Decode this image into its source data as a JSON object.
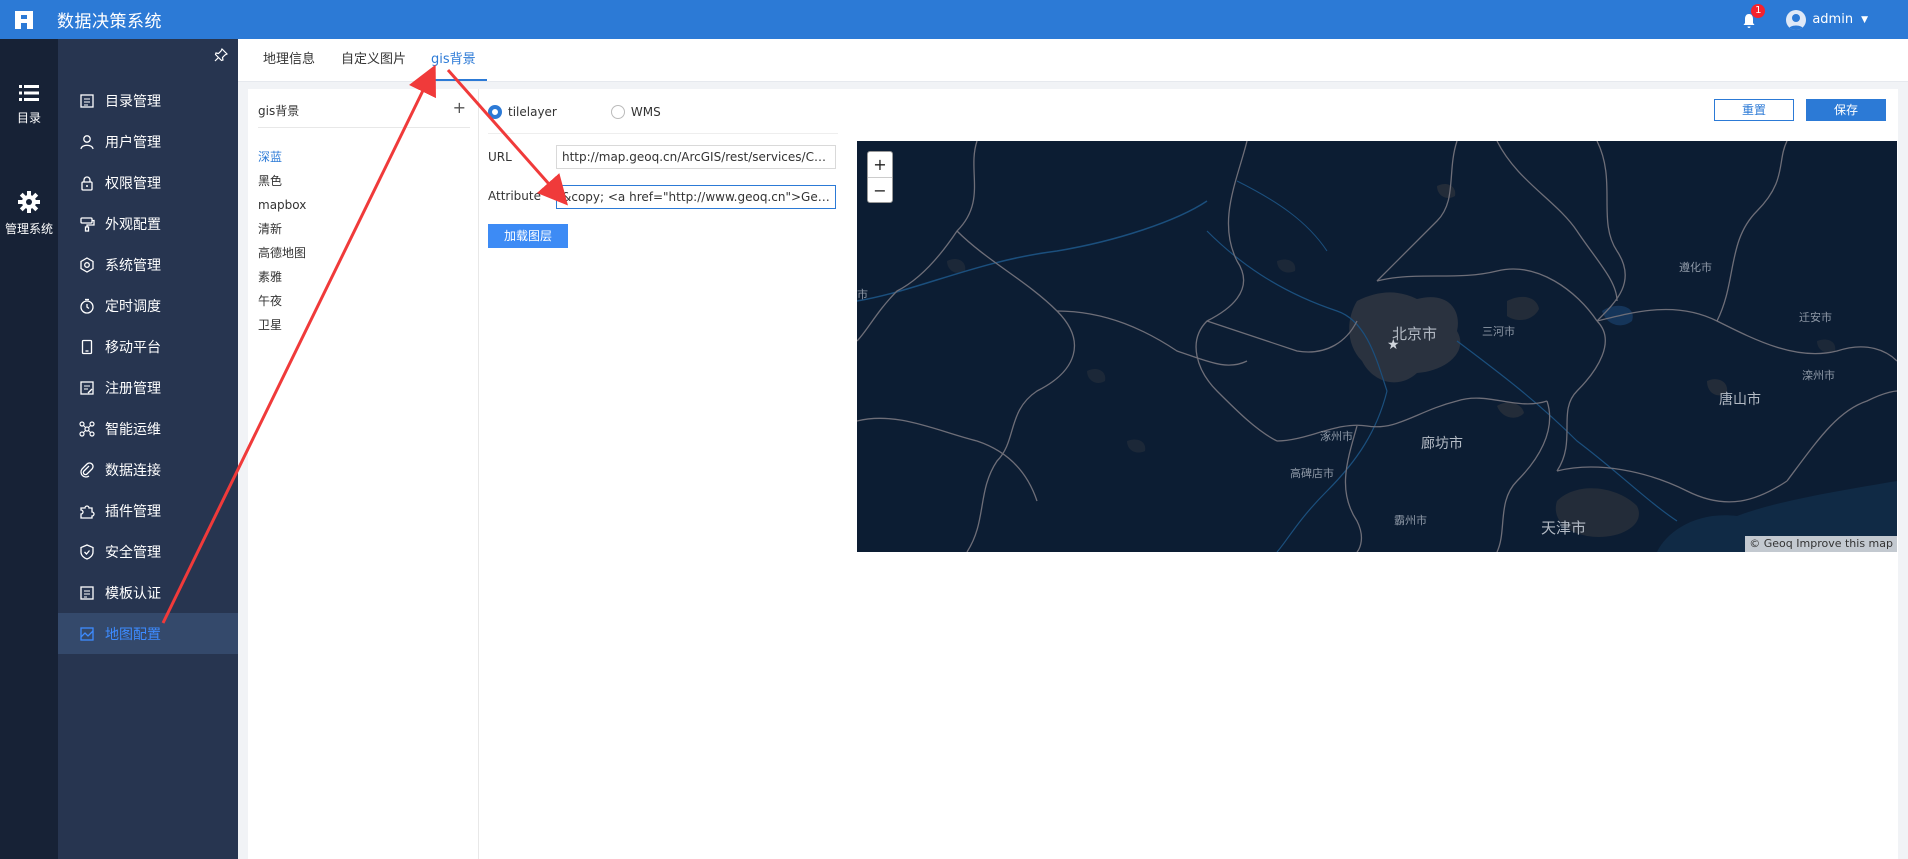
{
  "header": {
    "title": "数据决策系统",
    "notifications": "1",
    "user": "admin"
  },
  "rail": {
    "items": [
      {
        "label": "目录",
        "icon": "list-icon"
      },
      {
        "label": "管理系统",
        "icon": "gear-icon"
      }
    ]
  },
  "menu": {
    "items": [
      {
        "label": "目录管理",
        "icon": "catalog-icon"
      },
      {
        "label": "用户管理",
        "icon": "user-icon"
      },
      {
        "label": "权限管理",
        "icon": "lock-icon"
      },
      {
        "label": "外观配置",
        "icon": "paint-icon"
      },
      {
        "label": "系统管理",
        "icon": "settings-icon"
      },
      {
        "label": "定时调度",
        "icon": "clock-icon"
      },
      {
        "label": "移动平台",
        "icon": "mobile-icon"
      },
      {
        "label": "注册管理",
        "icon": "register-icon"
      },
      {
        "label": "智能运维",
        "icon": "network-icon"
      },
      {
        "label": "数据连接",
        "icon": "link-icon"
      },
      {
        "label": "插件管理",
        "icon": "puzzle-icon"
      },
      {
        "label": "安全管理",
        "icon": "shield-icon"
      },
      {
        "label": "模板认证",
        "icon": "template-icon"
      },
      {
        "label": "地图配置",
        "icon": "map-icon"
      }
    ],
    "active_index": 13
  },
  "tabs": [
    {
      "label": "地理信息"
    },
    {
      "label": "自定义图片"
    },
    {
      "label": "gis背景"
    }
  ],
  "gis_list": {
    "title": "gis背景",
    "add": "+",
    "items": [
      "深蓝",
      "黑色",
      "mapbox",
      "清新",
      "高德地图",
      "素雅",
      "午夜",
      "卫星"
    ],
    "active_index": 0
  },
  "form": {
    "layer_options": [
      "tilelayer",
      "WMS"
    ],
    "selected": "tilelayer",
    "url_label": "URL",
    "url_value": "http://map.geoq.cn/ArcGIS/rest/services/ChinaOnlineStreetPurplishBlue/MapServer/tile/{z}/{y}/{x}",
    "attribute_label": "Attribute",
    "attribute_value": "&copy; <a href=\"http://www.geoq.cn\">Geoq</a>",
    "load_button": "加载图层"
  },
  "actions": {
    "reset": "重置",
    "save": "保存"
  },
  "map": {
    "zoom_in": "+",
    "zoom_out": "−",
    "attribution": "© Geoq Improve this map",
    "cities": [
      "北京市",
      "三河市",
      "遵化市",
      "迁安市",
      "滦州市",
      "唐山市",
      "涿州市",
      "廊坊市",
      "高碑店市",
      "霸州市",
      "天津市",
      "市"
    ],
    "colors": {
      "background": "#0c1d33",
      "border": "#6e6e78",
      "river": "#1b4f7d",
      "urban": "#2b3340"
    }
  },
  "colors": {
    "primary": "#2c7ad6",
    "menu_bg": "#273550",
    "rail_bg": "#172236",
    "annotation": "#f03a3a"
  }
}
